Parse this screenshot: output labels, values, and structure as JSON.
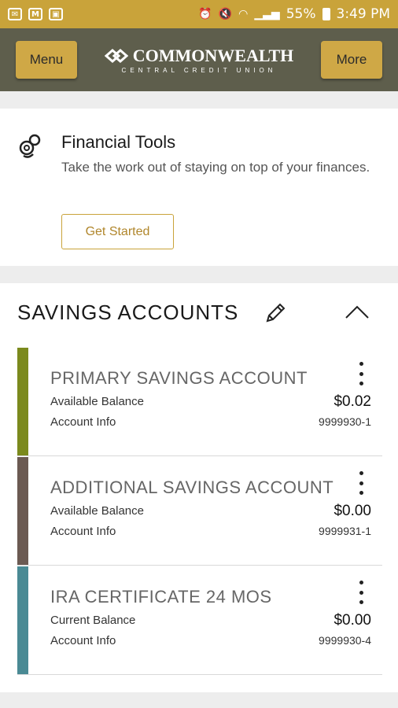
{
  "status_bar": {
    "battery": "55%",
    "time": "3:49 PM"
  },
  "header": {
    "menu_label": "Menu",
    "more_label": "More",
    "brand_name": "COMMONWEALTH",
    "brand_sub": "CENTRAL CREDIT UNION"
  },
  "financial_tools": {
    "title": "Financial Tools",
    "description": "Take the work out of staying on top of your finances.",
    "button_label": "Get Started"
  },
  "savings": {
    "section_title": "SAVINGS ACCOUNTS",
    "accounts": [
      {
        "name": "PRIMARY SAVINGS ACCOUNT",
        "balance_label": "Available Balance",
        "info_label": "Account Info",
        "amount": "$0.02",
        "number": "9999930-1",
        "color": "#7b8a1d"
      },
      {
        "name": "ADDITIONAL SAVINGS ACCOUNT",
        "balance_label": "Available Balance",
        "info_label": "Account Info",
        "amount": "$0.00",
        "number": "9999931-1",
        "color": "#6b5a52"
      },
      {
        "name": "IRA CERTIFICATE 24 MOS",
        "balance_label": "Current Balance",
        "info_label": "Account Info",
        "amount": "$0.00",
        "number": "9999930-4",
        "color": "#4a8a94"
      }
    ]
  }
}
